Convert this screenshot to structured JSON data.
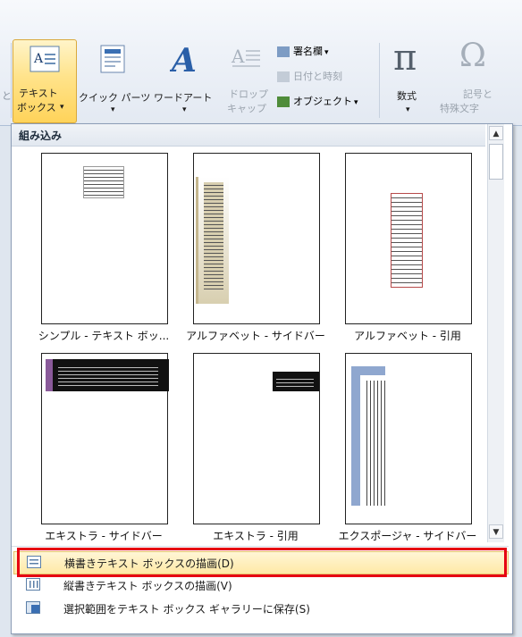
{
  "ribbon": {
    "textbox": {
      "label1": "テキスト",
      "label2": "ボックス"
    },
    "quickparts": {
      "label": "クイック パーツ"
    },
    "wordart": {
      "label": "ワードアート"
    },
    "dropcap": {
      "label1": "ドロップ",
      "label2": "キャップ"
    },
    "small_buttons": [
      "署名欄",
      "日付と時刻",
      "オブジェクト"
    ],
    "equation": {
      "label": "数式"
    },
    "symbol": {
      "label1": "記号と",
      "label2": "特殊文字"
    },
    "left_fragment": "と"
  },
  "gallery": {
    "header": "組み込み",
    "items": [
      {
        "caption": "シンプル - テキスト ボッ..."
      },
      {
        "caption": "アルファベット - サイドバー"
      },
      {
        "caption": "アルファベット - 引用"
      },
      {
        "caption": "エキストラ - サイドバー"
      },
      {
        "caption": "エキストラ - 引用"
      },
      {
        "caption": "エクスポージャ - サイドバー"
      }
    ]
  },
  "menu": [
    {
      "label": "横書きテキスト ボックスの描画(D)",
      "icon": "horizontal-textbox-icon",
      "highlighted": true
    },
    {
      "label": "縦書きテキスト ボックスの描画(V)",
      "icon": "vertical-textbox-icon",
      "highlighted": false
    },
    {
      "label": "選択範囲をテキスト ボックス ギャラリーに保存(S)",
      "icon": "save-selection-icon",
      "highlighted": false
    }
  ],
  "colors": {
    "highlight": "#ffe38a",
    "callout": "#e60012"
  }
}
